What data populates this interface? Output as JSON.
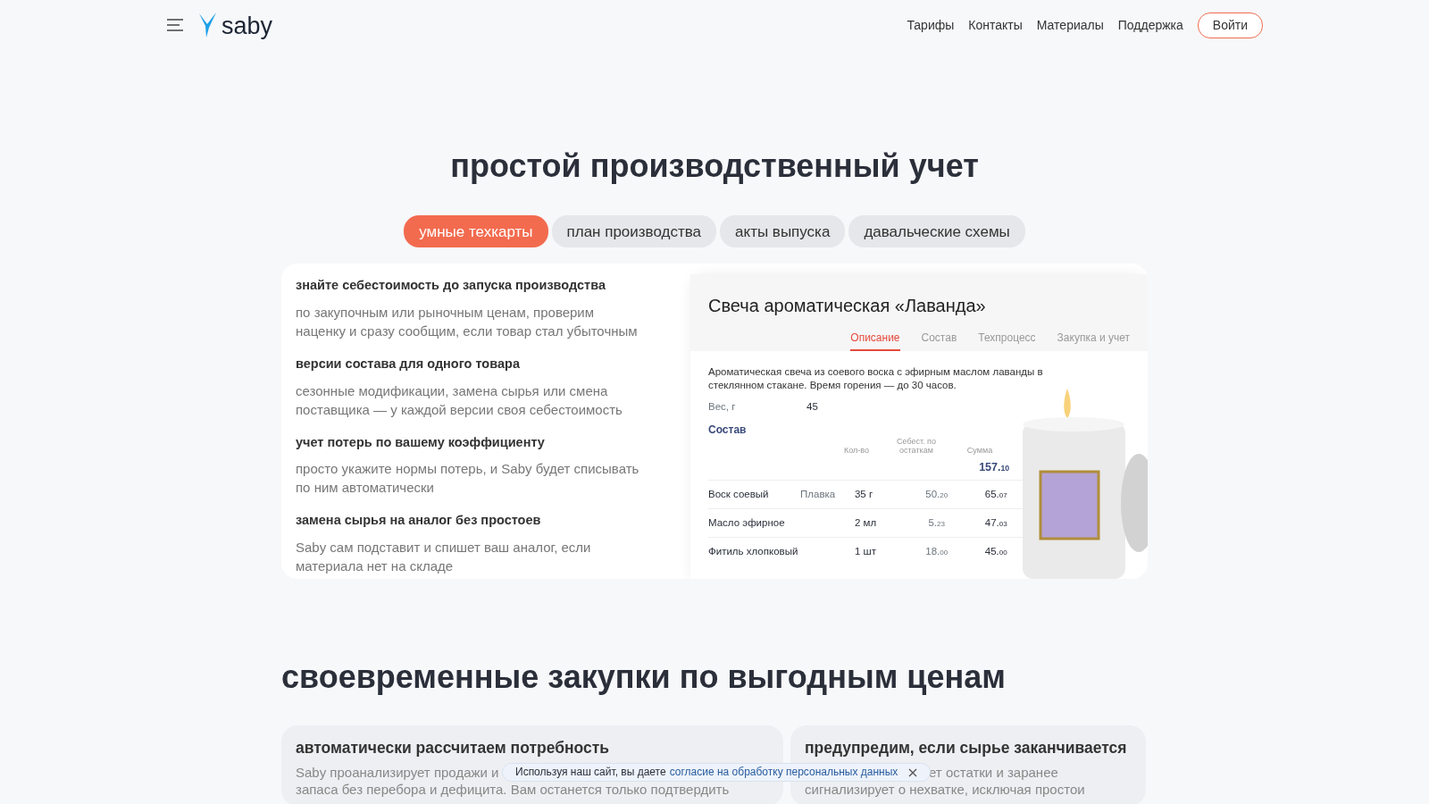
{
  "header": {
    "logo": "saby",
    "nav": [
      "Тарифы",
      "Контакты",
      "Материалы",
      "Поддержка"
    ],
    "login": "Войти"
  },
  "section1": {
    "title": "простой производственный учет",
    "tabs": [
      {
        "label": "умные техкарты",
        "selected": true
      },
      {
        "label": "план производства",
        "selected": false
      },
      {
        "label": "акты выпуска",
        "selected": false
      },
      {
        "label": "давальческие схемы",
        "selected": false
      }
    ],
    "features": [
      {
        "title": "знайте себестоимость до запуска производства",
        "text": "по закупочным или рыночным ценам, проверим наценку и сразу сообщим, если товар стал убыточным"
      },
      {
        "title": "версии состава для одного товара",
        "text": "сезонные модификации, замена сырья или смена поставщика — у каждой версии своя себестоимость"
      },
      {
        "title": "учет потерь по вашему коэффициенту",
        "text": "просто укажите нормы потерь, и Saby будет списывать по ним автоматически"
      },
      {
        "title": "замена сырья на аналог без простоев",
        "text": "Saby сам подставит и спишет ваш аналог, если материала нет на складе"
      }
    ],
    "product": {
      "title": "Свеча ароматическая «Лаванда»",
      "tabs": [
        {
          "label": "Описание",
          "selected": true
        },
        {
          "label": "Состав",
          "selected": false
        },
        {
          "label": "Техпроцесс",
          "selected": false
        },
        {
          "label": "Закупка и учет",
          "selected": false
        }
      ],
      "description": "Ароматическая свеча из соевого воска с эфирным маслом лаванды в стеклянном стакане. Время горения — до 30 часов.",
      "weight_label": "Вес, г",
      "weight_value": "45",
      "composition_title": "Состав",
      "columns": [
        "Кол-во",
        "Себест. по остаткам",
        "Сумма"
      ],
      "total": "157.$_{10}$",
      "rows": [
        {
          "name": "Воск соевый",
          "note": "Плавка",
          "qty": "35 г",
          "cost": "50.$_{20}$",
          "sum": "65.$_{07}$"
        },
        {
          "name": "Масло эфирное",
          "qty": "2 мл",
          "cost": "5.$_{23}$",
          "sum": "47.$_{03}$"
        },
        {
          "name": "Фитиль хлопковый",
          "qty": "1 шт",
          "cost": "18.$_{00}$",
          "sum": "45.$_{00}$"
        }
      ]
    }
  },
  "section2": {
    "title": "своевременные закупки по выгодным ценам",
    "cards": [
      {
        "title": "автоматически рассчитаем потребность",
        "lines": [
          "Saby проанализирует продажи и",
          "запаса без перебора и дефицита. Вам останется только подтвердить"
        ]
      },
      {
        "title": "предупредим, если сырье заканчивается",
        "lines": [
          "ет остатки и заранее",
          "сигнализирует о нехватке, исключая простои"
        ]
      }
    ]
  },
  "cookie": {
    "text": "Используя наш сайт, вы даете",
    "link": "согласие на обработку персональных данных"
  }
}
